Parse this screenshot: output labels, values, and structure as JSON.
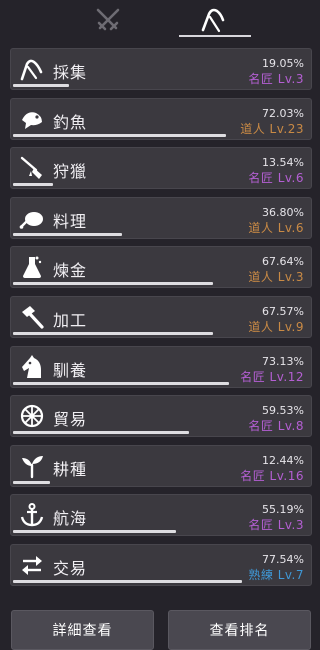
{
  "tabs": [
    {
      "icon": "crossed-swords-icon",
      "active": false
    },
    {
      "icon": "sickle-icon",
      "active": true
    }
  ],
  "colors": {
    "rank_master": "#b45fd3",
    "rank_artisan": "#c98a45",
    "rank_skilled": "#3f98d6",
    "progress_bar": "#dedde1"
  },
  "skills": [
    {
      "name": "採集",
      "icon": "sickle-icon",
      "percent": "19.05%",
      "progress": 0.19,
      "rank": "名匠 Lv.3",
      "rank_tier": "purple"
    },
    {
      "name": "釣魚",
      "icon": "fish-icon",
      "percent": "72.03%",
      "progress": 0.72,
      "rank": "道人 Lv.23",
      "rank_tier": "orange"
    },
    {
      "name": "狩獵",
      "icon": "rifle-icon",
      "percent": "13.54%",
      "progress": 0.135,
      "rank": "名匠 Lv.6",
      "rank_tier": "purple"
    },
    {
      "name": "料理",
      "icon": "roast-meat-icon",
      "percent": "36.80%",
      "progress": 0.368,
      "rank": "道人 Lv.6",
      "rank_tier": "orange"
    },
    {
      "name": "煉金",
      "icon": "flask-icon",
      "percent": "67.64%",
      "progress": 0.676,
      "rank": "道人 Lv.3",
      "rank_tier": "orange"
    },
    {
      "name": "加工",
      "icon": "hammer-icon",
      "percent": "67.57%",
      "progress": 0.676,
      "rank": "道人 Lv.9",
      "rank_tier": "orange"
    },
    {
      "name": "馴養",
      "icon": "horse-head-icon",
      "percent": "73.13%",
      "progress": 0.731,
      "rank": "名匠 Lv.12",
      "rank_tier": "purple"
    },
    {
      "name": "貿易",
      "icon": "ship-wheel-icon",
      "percent": "59.53%",
      "progress": 0.595,
      "rank": "名匠 Lv.8",
      "rank_tier": "purple"
    },
    {
      "name": "耕種",
      "icon": "sprout-icon",
      "percent": "12.44%",
      "progress": 0.124,
      "rank": "名匠 Lv.16",
      "rank_tier": "purple"
    },
    {
      "name": "航海",
      "icon": "anchor-icon",
      "percent": "55.19%",
      "progress": 0.552,
      "rank": "名匠 Lv.3",
      "rank_tier": "purple"
    },
    {
      "name": "交易",
      "icon": "exchange-arrows-icon",
      "percent": "77.54%",
      "progress": 0.775,
      "rank": "熟練 Lv.7",
      "rank_tier": "blue"
    }
  ],
  "buttons": {
    "detail_label": "詳細查看",
    "ranking_label": "查看排名"
  }
}
